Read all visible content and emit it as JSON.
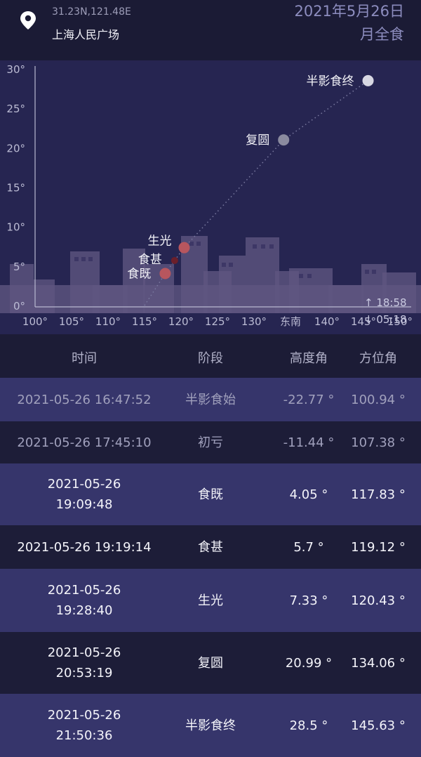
{
  "location": {
    "coords": "31.23N,121.48E",
    "name": "上海人民广场",
    "icon": "map-pin-icon"
  },
  "eclipse": {
    "date": "2021年5月26日",
    "type": "月全食"
  },
  "chart_data": {
    "type": "scatter",
    "title": "",
    "xlabel": "",
    "ylabel": "",
    "x_ticks": [
      "100°",
      "105°",
      "110°",
      "115°",
      "120°",
      "125°",
      "130°",
      "东南",
      "140°",
      "145°",
      "150°"
    ],
    "y_ticks": [
      "0°",
      "5°",
      "10°",
      "15°",
      "20°",
      "25°",
      "30°"
    ],
    "xlim": [
      100,
      150
    ],
    "ylim": [
      0,
      30
    ],
    "series": [
      {
        "points": [
          {
            "label": "食既",
            "x": 117.83,
            "y": 4.05,
            "color": "#b7565e"
          },
          {
            "label": "食甚",
            "x": 119.12,
            "y": 5.7,
            "color": "#6b1f2b"
          },
          {
            "label": "生光",
            "x": 120.43,
            "y": 7.33,
            "color": "#b7565e"
          },
          {
            "label": "复圆",
            "x": 134.06,
            "y": 20.99,
            "color": "#8b8b9f"
          },
          {
            "label": "半影食终",
            "x": 145.63,
            "y": 28.5,
            "color": "#d7d7e2"
          }
        ]
      }
    ],
    "path_color": "#7a7aa0"
  },
  "times": {
    "rise": "↑ 18:58",
    "set": "↓ 05:18"
  },
  "table": {
    "headers": [
      "时间",
      "阶段",
      "高度角",
      "方位角"
    ],
    "rows": [
      {
        "time1": "2021-05-26 16:47:52",
        "time2": "",
        "phase": "半影食始",
        "alt": "-22.77 °",
        "az": "100.94 °",
        "dim": true
      },
      {
        "time1": "2021-05-26 17:45:10",
        "time2": "",
        "phase": "初亏",
        "alt": "-11.44 °",
        "az": "107.38 °",
        "dim": true
      },
      {
        "time1": "2021-05-26",
        "time2": "19:09:48",
        "phase": "食既",
        "alt": "4.05 °",
        "az": "117.83 °",
        "dim": false
      },
      {
        "time1": "2021-05-26 19:19:14",
        "time2": "",
        "phase": "食甚",
        "alt": "5.7 °",
        "az": "119.12 °",
        "dim": false
      },
      {
        "time1": "2021-05-26",
        "time2": "19:28:40",
        "phase": "生光",
        "alt": "7.33 °",
        "az": "120.43 °",
        "dim": false
      },
      {
        "time1": "2021-05-26",
        "time2": "20:53:19",
        "phase": "复圆",
        "alt": "20.99 °",
        "az": "134.06 °",
        "dim": false
      },
      {
        "time1": "2021-05-26",
        "time2": "21:50:36",
        "phase": "半影食终",
        "alt": "28.5 °",
        "az": "145.63 °",
        "dim": false
      }
    ]
  },
  "colors": {
    "row_odd": "#36356b",
    "row_even": "#1d1d38"
  }
}
